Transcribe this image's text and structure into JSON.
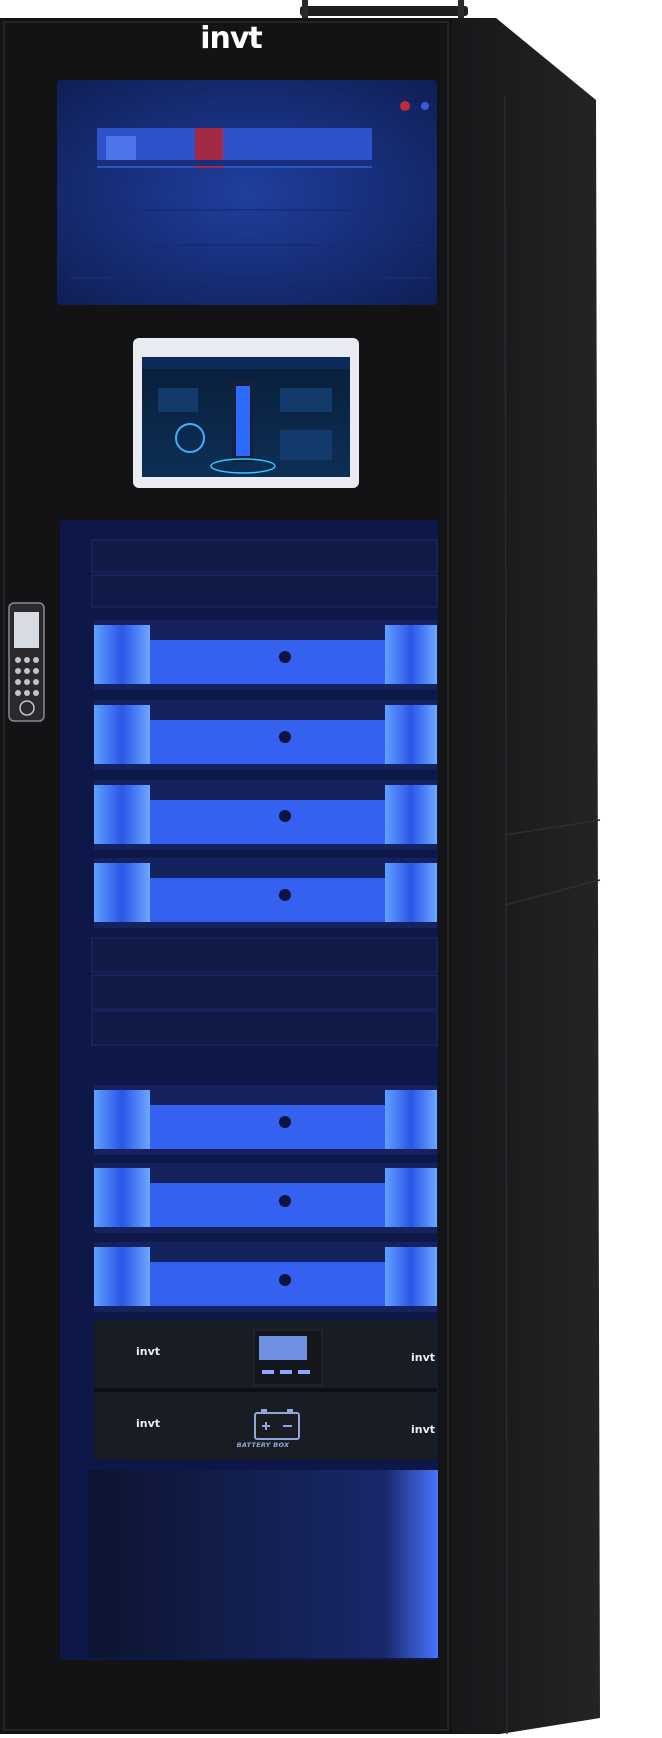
{
  "product": {
    "brand_logo": "invt",
    "ups_logo": "invt",
    "battery_label": "BATTERY BOX"
  },
  "colors": {
    "cabinet_black": "#141416",
    "side_panel": "#1c1c1e",
    "glow_blue": "#3a6cf0",
    "bezel_light_blue": "#8fb6ff"
  },
  "icons": {
    "door_lock": "keypad-lock-icon",
    "battery": "battery-icon",
    "touch_display": "monitoring-screen-icon"
  }
}
